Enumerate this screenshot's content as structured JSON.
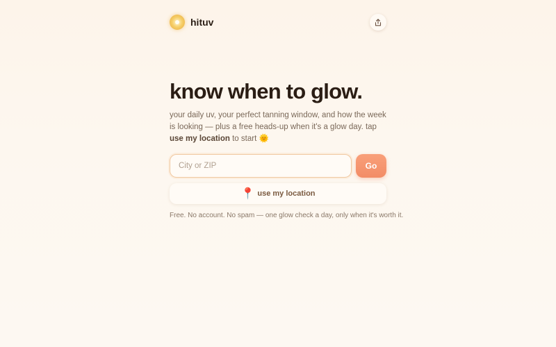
{
  "header": {
    "brand_name": "hituv",
    "logo_icon": "sun-glow-icon",
    "share_icon": "share-icon"
  },
  "hero": {
    "headline": "know when to glow.",
    "subtext_part1": "your daily uv, your perfect tanning window, and how the week is looking — plus a free heads-up when it's a glow day. tap ",
    "subtext_bold": "use my location",
    "subtext_part2": " to start ",
    "subtext_emoji": "🌞"
  },
  "form": {
    "city_placeholder": "City or ZIP",
    "city_value": "",
    "go_label": "Go",
    "location_emoji": "📍",
    "location_label": "use my location"
  },
  "footer": {
    "note": "Free. No account. No spam — one glow check a day, only when it's worth it."
  },
  "colors": {
    "accent": "#f28c66",
    "background": "#fdf6ee",
    "text": "#2a1d14"
  }
}
